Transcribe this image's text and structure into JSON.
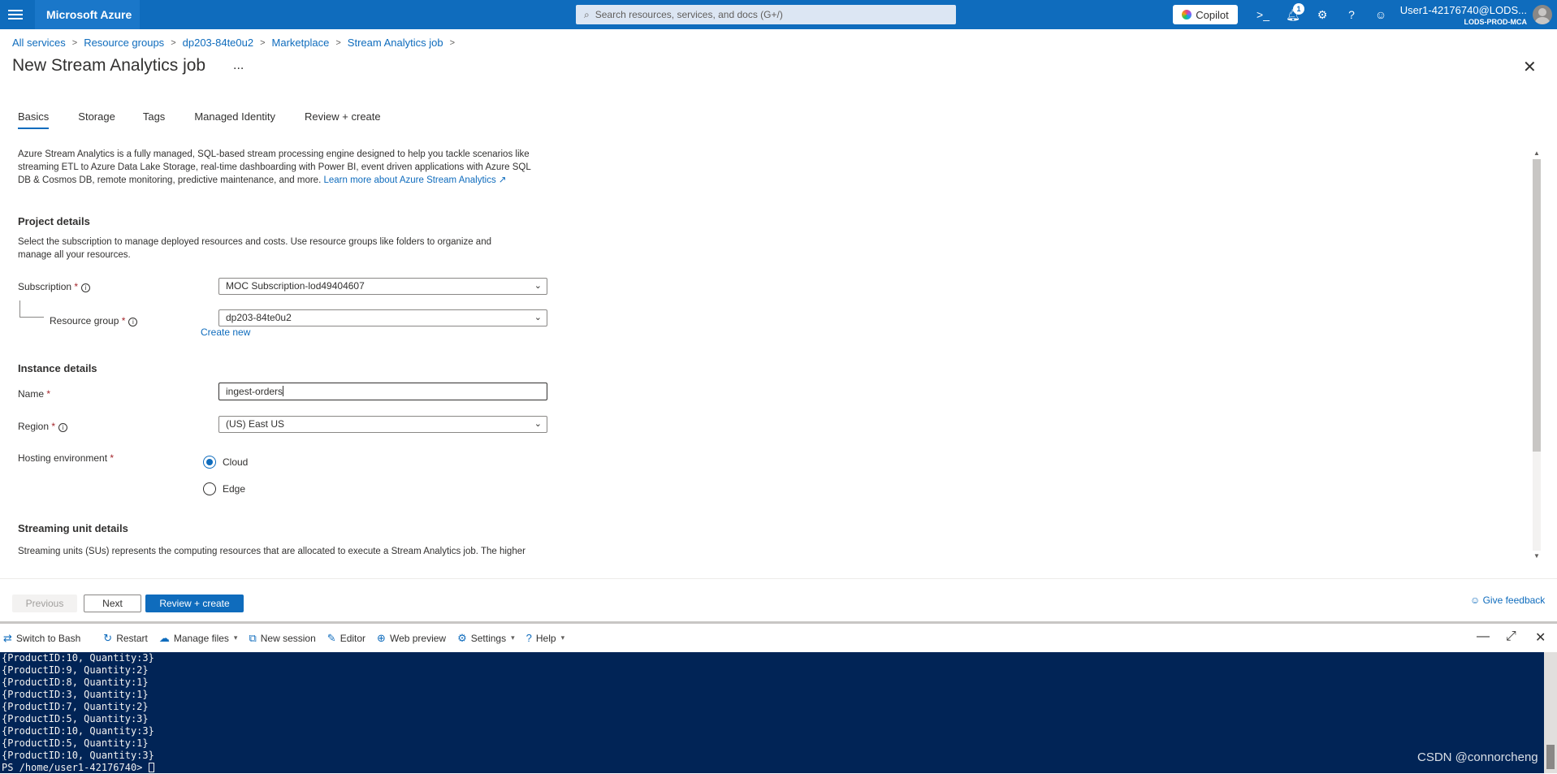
{
  "topbar": {
    "brand": "Microsoft Azure",
    "search_placeholder": "Search resources, services, and docs (G+/)",
    "copilot_label": "Copilot",
    "notification_count": "1",
    "user_name": "User1-42176740@LODS...",
    "user_tenant": "LODS-PROD-MCA"
  },
  "breadcrumb": {
    "items": [
      "All services",
      "Resource groups",
      "dp203-84te0u2",
      "Marketplace",
      "Stream Analytics job"
    ]
  },
  "page": {
    "title": "New Stream Analytics job",
    "more": "..."
  },
  "tabs": [
    "Basics",
    "Storage",
    "Tags",
    "Managed Identity",
    "Review + create"
  ],
  "intro": {
    "text": "Azure Stream Analytics is a fully managed, SQL-based stream processing engine designed to help you tackle scenarios like streaming ETL to Azure Data Lake Storage, real-time dashboarding with Power BI, event driven applications with Azure SQL DB & Cosmos DB, remote monitoring, predictive maintenance, and more.",
    "link": "Learn more about Azure Stream Analytics"
  },
  "project": {
    "heading": "Project details",
    "desc": "Select the subscription to manage deployed resources and costs. Use resource groups like folders to organize and manage all your resources.",
    "subscription_label": "Subscription",
    "subscription_value": "MOC Subscription-lod49404607",
    "rg_label": "Resource group",
    "rg_value": "dp203-84te0u2",
    "create_new": "Create new"
  },
  "instance": {
    "heading": "Instance details",
    "name_label": "Name",
    "name_value": "ingest-orders",
    "region_label": "Region",
    "region_value": "(US) East US",
    "hosting_label": "Hosting environment",
    "option_cloud": "Cloud",
    "option_edge": "Edge"
  },
  "streaming": {
    "heading": "Streaming unit details",
    "desc": "Streaming units (SUs) represents the computing resources that are allocated to execute a Stream Analytics job. The higher"
  },
  "footer": {
    "previous": "Previous",
    "next": "Next",
    "review": "Review + create",
    "feedback": "Give feedback"
  },
  "shell": {
    "items": [
      "Switch to Bash",
      "Restart",
      "Manage files",
      "New session",
      "Editor",
      "Web preview",
      "Settings",
      "Help"
    ]
  },
  "terminal": {
    "lines": [
      "{ProductID:10, Quantity:3}",
      "{ProductID:9, Quantity:2}",
      "{ProductID:8, Quantity:1}",
      "{ProductID:3, Quantity:1}",
      "{ProductID:7, Quantity:2}",
      "{ProductID:5, Quantity:3}",
      "{ProductID:10, Quantity:3}",
      "{ProductID:5, Quantity:1}",
      "{ProductID:10, Quantity:3}"
    ],
    "prompt": "PS /home/user1-42176740> "
  },
  "watermark": "CSDN @connorcheng"
}
